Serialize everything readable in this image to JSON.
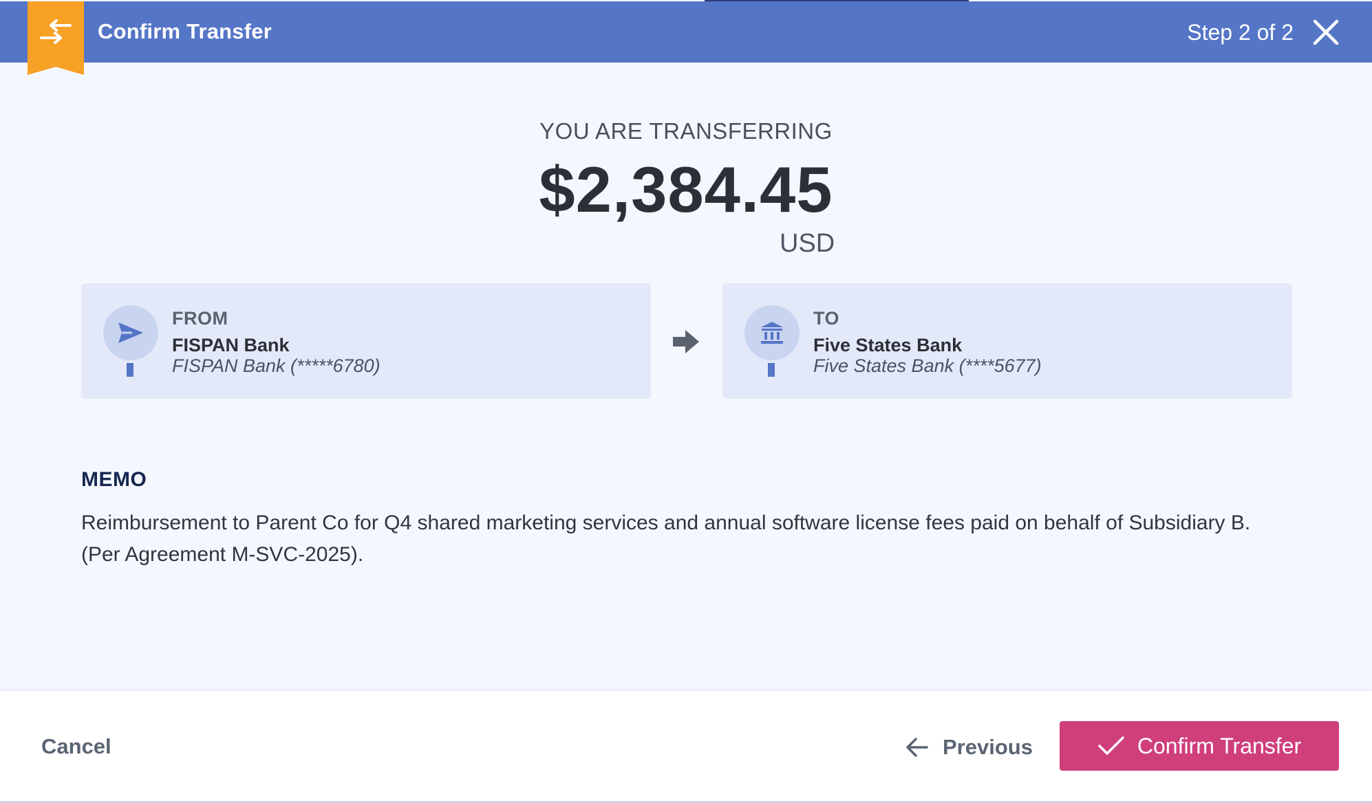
{
  "header": {
    "title": "Confirm Transfer",
    "step": "Step 2 of 2",
    "badge_icon": "transfer-arrows-icon",
    "close_icon": "close-icon",
    "bg_color": "#5575c7",
    "badge_color": "#f7a125"
  },
  "summary": {
    "label": "YOU ARE TRANSFERRING",
    "amount": "$2,384.45",
    "currency": "USD"
  },
  "from": {
    "label": "FROM",
    "bank": "FISPAN Bank",
    "account": "FISPAN Bank (*****6780)",
    "icon": "send-icon"
  },
  "to": {
    "label": "TO",
    "bank": "Five States Bank",
    "account": "Five States Bank (****5677)",
    "icon": "bank-icon"
  },
  "direction_icon": "arrow-right-icon",
  "memo": {
    "title": "MEMO",
    "text": "Reimbursement to Parent Co for Q4 shared marketing services and annual software license fees paid on behalf of Subsidiary B. (Per Agreement M-SVC-2025)."
  },
  "footer": {
    "cancel_label": "Cancel",
    "previous_label": "Previous",
    "confirm_label": "Confirm Transfer",
    "confirm_color": "#cf3f7b"
  }
}
